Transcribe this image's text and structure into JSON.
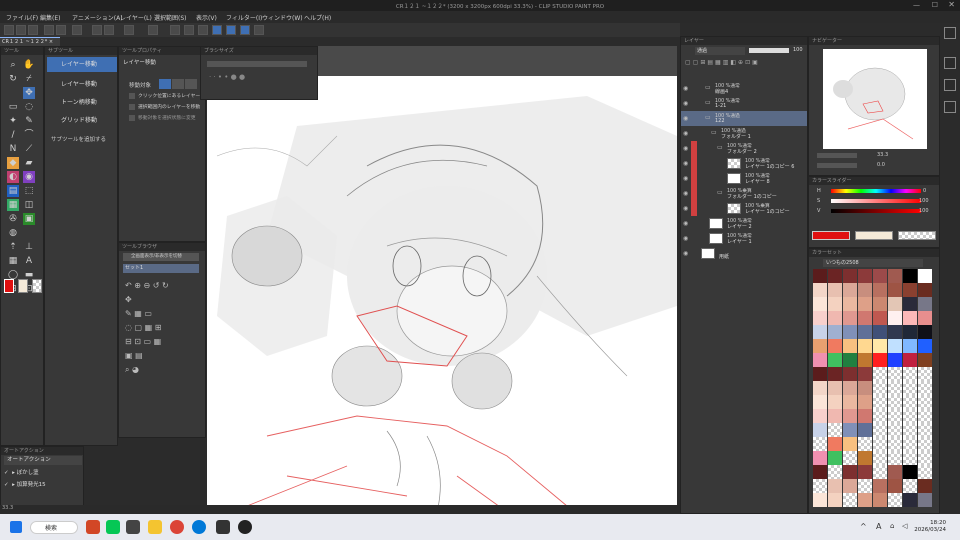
{
  "window": {
    "title": "CR１２１ ~１２２* (3200 x 3200px 600dpi 33.3%) - CLIP STUDIO PAINT PRO"
  },
  "menu": [
    "ファイル(F)",
    "編集(E)",
    "アニメーション(A)",
    "レイヤー(L)",
    "選択範囲(S)",
    "表示(V)",
    "フィルター(I)",
    "ウィンドウ(W)",
    "ヘルプ(H)"
  ],
  "document": {
    "tab": "CR１２１ ~１２２* ×"
  },
  "subtool": {
    "header": "サブツール",
    "items": [
      "レイヤー移動",
      "レイヤー移動",
      "トーン柄移動",
      "グリッド移動"
    ],
    "add": "サブツールを追加する"
  },
  "toolprop": {
    "header": "ツールプロパティ",
    "name": "レイヤー移動",
    "target_label": "移動対象",
    "opt1": "クリック位置にあるレイヤーを移動",
    "opt2": "選択範囲内のレイヤーを移動",
    "opt3": "移動対象を選択状態に変更"
  },
  "brushsize": {
    "header": "ブラシサイズ"
  },
  "tooldetail": {
    "header": "ツールブラウザ",
    "search": "全画面表示/非表示を切替",
    "set": "セット1"
  },
  "autoaction": {
    "header": "オートアクション",
    "dropdown": "オートアクション",
    "items": [
      "ぼかし塗",
      "加算発光15"
    ]
  },
  "layers": {
    "header": "レイヤー",
    "blend": "通過",
    "opacity": "100",
    "rows": [
      {
        "pct": "100 %通常",
        "name": "線画4"
      },
      {
        "pct": "100 %通常",
        "name": "1-21"
      },
      {
        "pct": "100 %通過",
        "name": "122"
      },
      {
        "pct": "100 %通過",
        "name": "フォルダー 1"
      },
      {
        "pct": "100 %通常",
        "name": "フォルダー 2"
      },
      {
        "pct": "100 %通常",
        "name": "レイヤー 1のコピー 6"
      },
      {
        "pct": "100 %通常",
        "name": "レイヤー 8"
      },
      {
        "pct": "100 %乗算",
        "name": "フォルダー 1のコピー"
      },
      {
        "pct": "100 %乗算",
        "name": "レイヤー 1のコピー"
      },
      {
        "pct": "100 %通常",
        "name": "レイヤー 2"
      },
      {
        "pct": "100 %通常",
        "name": "レイヤー 1"
      },
      {
        "pct": "",
        "name": "用紙"
      }
    ]
  },
  "navigator": {
    "header": "ナビゲーター",
    "zoom": "33.3",
    "angle": "0.0"
  },
  "colorslider": {
    "header": "カラースライダー",
    "h": "0",
    "s": "100",
    "v": "100",
    "hl": "H",
    "sl": "S",
    "vl": "V"
  },
  "colorset": {
    "header": "カラーセット",
    "name": "いつもの2508"
  },
  "status": {
    "zoom": "33.3"
  },
  "taskbar": {
    "search": "検索",
    "time": "18:20",
    "date": "2026/03/24",
    "ime": "A"
  },
  "colors": {
    "accent": "#3f6fb3",
    "fg": "#e01010",
    "bg": "#f5ead8"
  },
  "palette": [
    "#5b1c1c",
    "#6b2424",
    "#7d2f2f",
    "#8c3a3a",
    "#9c4a4a",
    "#a05a50",
    "#000000",
    "#ffffff",
    "#f3d6c8",
    "#e8c0b0",
    "#dba898",
    "#c88e7e",
    "#b87060",
    "#9e5444",
    "#8a4030",
    "#6a2c20",
    "#fbe5d8",
    "#f4d2c0",
    "#eab8a0",
    "#dea088",
    "#cc8870",
    "#e3c6b5",
    "#2a2a3a",
    "#777788",
    "#f8d0cc",
    "#f0b8b0",
    "#e09890",
    "#d07870",
    "#c05850",
    "#fff0f0",
    "#fcb8b8",
    "#e88e8e",
    "#c8d2e8",
    "#a0b0d0",
    "#8090b8",
    "#607098",
    "#405078",
    "#303850",
    "#202838",
    "#101018",
    "#e8a070",
    "#f07a60",
    "#f8c080",
    "#ffd890",
    "#ffe8a8",
    "#c0e0ff",
    "#80b8ff",
    "#2060ff",
    "#f090b0",
    "#40c060",
    "#208040",
    "#c07830",
    "#ff2020",
    "#2040ff",
    "#c02040",
    "#804020"
  ]
}
